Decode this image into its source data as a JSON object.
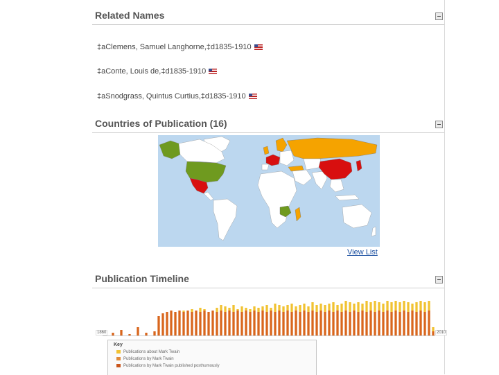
{
  "sections": {
    "related": "Related Names",
    "countries": "Countries of Publication (16)",
    "timeline": "Publication Timeline"
  },
  "related_names": [
    "‡aClemens, Samuel Langhorne,‡d1835-1910",
    "‡aConte, Louis de,‡d1835-1910",
    "‡aSnodgrass, Quintus Curtius,‡d1835-1910"
  ],
  "view_list": "View List",
  "colors": {
    "ocean": "#bcd7ef",
    "land": "#ffffff",
    "green": "#6f9a1f",
    "orange": "#f5a300",
    "red": "#d80f0f",
    "bar_light": "#f1c232",
    "bar_dark": "#d9661d"
  },
  "timeline": {
    "start_label": "1860",
    "end_label": "2010",
    "bars_light": [
      0,
      0,
      0,
      0,
      0,
      0,
      0,
      0,
      0,
      0,
      0,
      0,
      0,
      18,
      26,
      30,
      36,
      32,
      34,
      36,
      34,
      38,
      36,
      40,
      38,
      34,
      36,
      40,
      44,
      42,
      40,
      44,
      38,
      42,
      40,
      38,
      42,
      40,
      42,
      44,
      40,
      46,
      44,
      42,
      44,
      46,
      42,
      44,
      46,
      42,
      48,
      44,
      46,
      44,
      46,
      48,
      44,
      46,
      50,
      48,
      46,
      48,
      46,
      50,
      48,
      50,
      48,
      46,
      50,
      48,
      50,
      48,
      50,
      48,
      46,
      48,
      50,
      48,
      50,
      12
    ],
    "bars_dark": [
      2,
      0,
      4,
      0,
      8,
      0,
      2,
      0,
      12,
      0,
      4,
      0,
      6,
      28,
      32,
      34,
      36,
      34,
      36,
      34,
      36,
      34,
      36,
      34,
      36,
      34,
      36,
      34,
      36,
      34,
      36,
      34,
      36,
      34,
      36,
      34,
      36,
      34,
      36,
      34,
      36,
      34,
      36,
      34,
      36,
      34,
      36,
      34,
      36,
      34,
      36,
      34,
      36,
      34,
      36,
      34,
      36,
      34,
      36,
      34,
      36,
      34,
      36,
      34,
      36,
      34,
      36,
      34,
      36,
      34,
      36,
      34,
      36,
      34,
      36,
      34,
      36,
      34,
      36,
      6
    ]
  },
  "key": {
    "title": "Key",
    "items": [
      {
        "label": "Publications about Mark Twain",
        "color": "#f1c232"
      },
      {
        "label": "Publications by Mark Twain",
        "color": "#e08a3a"
      },
      {
        "label": "Publications by Mark Twain published posthumously",
        "color": "#c9551b"
      }
    ]
  }
}
